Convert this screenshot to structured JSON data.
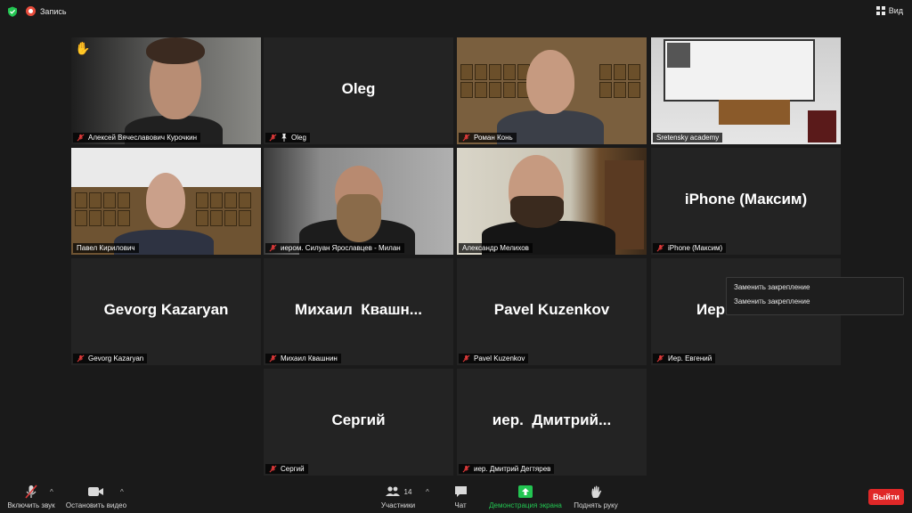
{
  "top": {
    "recording_label": "Запись",
    "view_label": "Вид"
  },
  "tiles": [
    {
      "name": "Алексей Вячеславович Курочкин",
      "muted": true,
      "hand_raised": true,
      "video": true
    },
    {
      "name": "Oleg",
      "display": "Oleg",
      "muted": true,
      "pinned": true
    },
    {
      "name": "Роман Конь",
      "muted": true,
      "video": true
    },
    {
      "name": "Sretensky academy",
      "video": true
    },
    {
      "name": "Павел Кирилович",
      "video": true
    },
    {
      "name": "иером. Силуан Ярославцев - Милан",
      "muted": true,
      "video": true
    },
    {
      "name": "Александр Мелихов",
      "video": true,
      "active_speaker": true
    },
    {
      "name": "iPhone (Максим)",
      "display": "iPhone (Максим)",
      "muted": true
    },
    {
      "name": "Gevorg Kazaryan",
      "display": "Gevorg Kazaryan",
      "muted": true
    },
    {
      "name": "Михаил Квашнин",
      "display": "Михаил  Квашн...",
      "muted": true
    },
    {
      "name": "Pavel Kuzenkov",
      "display": "Pavel Kuzenkov",
      "muted": true
    },
    {
      "name": "Иер. Евгений",
      "display": "Иер. Евгений",
      "muted": true
    },
    {
      "name": "Сергий",
      "display": "Сергий",
      "muted": true
    },
    {
      "name": "иер. Дмитрий Дегтярев",
      "display": "иер.  Дмитрий...",
      "muted": true
    }
  ],
  "context_menu": {
    "items": [
      "Заменить закрепление",
      "Заменить закрепление"
    ]
  },
  "toolbar": {
    "unmute_label": "Включить звук",
    "stop_video_label": "Остановить видео",
    "participants_label": "Участники",
    "participants_count": "14",
    "chat_label": "Чат",
    "share_label": "Демонстрация экрана",
    "raise_hand_label": "Поднять руку",
    "leave_label": "Выйти"
  },
  "colors": {
    "active_speaker_border": "#cde06a",
    "leave_button": "#e02828",
    "share_icon": "#23c552",
    "mute_icon": "#e03a3a"
  }
}
